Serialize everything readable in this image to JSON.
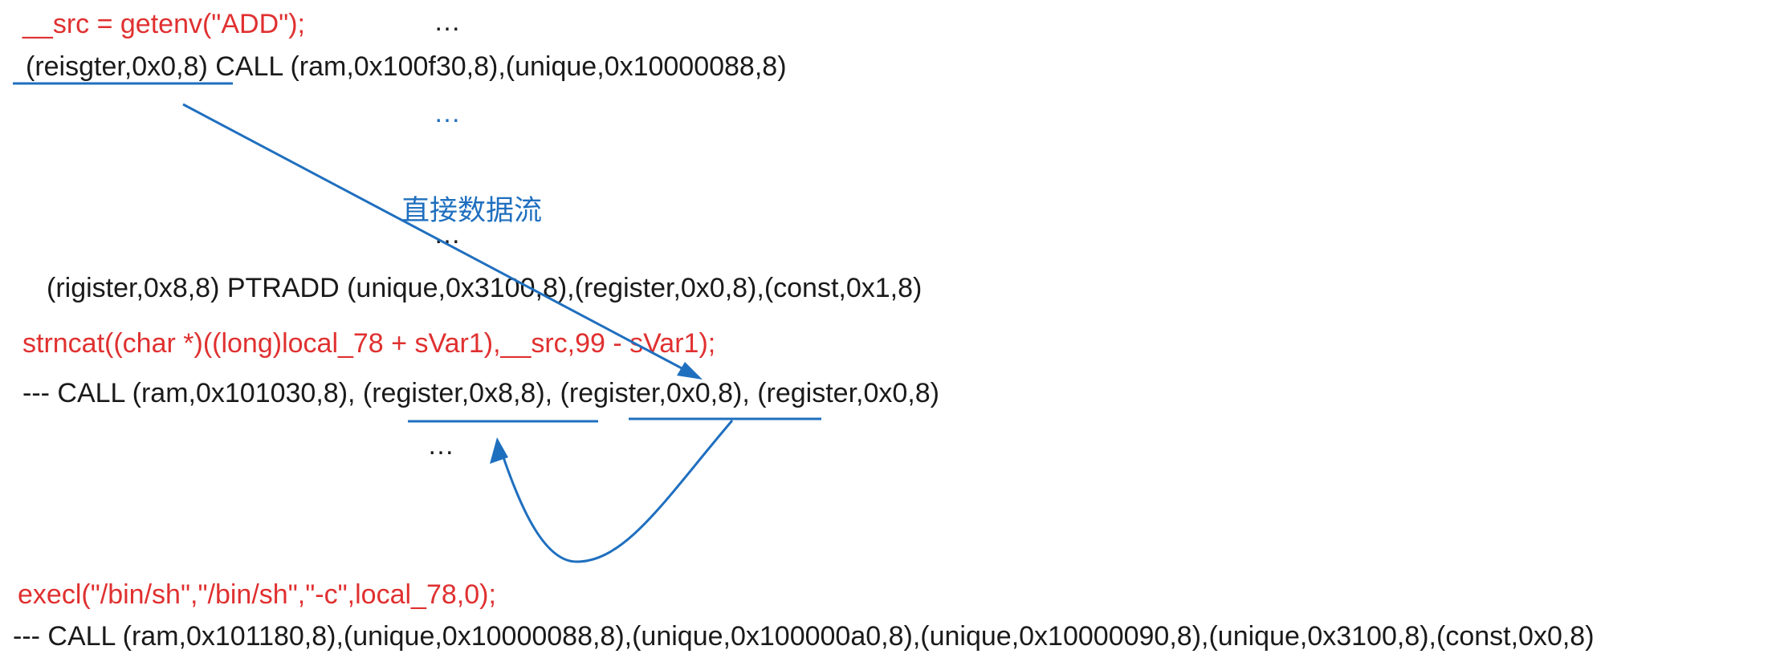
{
  "lines": {
    "src_getenv": "__src = getenv(\"ADD\");",
    "ellipsis_top": "…",
    "call_getenv": "(reisgter,0x0,8) CALL (ram,0x100f30,8),(unique,0x10000088,8)",
    "ellipsis_blue": "…",
    "direct_dataflow_label": "直接数据流",
    "ellipsis_mid": "…",
    "ptradd": "(rigister,0x8,8) PTRADD (unique,0x3100,8),(register,0x0,8),(const,0x1,8)",
    "strncat_src": "strncat((char *)((long)local_78 + sVar1),__src,99 - sVar1);",
    "call_strncat": "--- CALL (ram,0x101030,8), (register,0x8,8), (register,0x0,8), (register,0x0,8)",
    "ellipsis_low": "…",
    "execl_src": "execl(\"/bin/sh\",\"/bin/sh\",\"-c\",local_78,0);",
    "call_execl": "--- CALL (ram,0x101180,8),(unique,0x10000088,8),(unique,0x100000a0,8),(unique,0x10000090,8),(unique,0x3100,8),(const,0x0,8)"
  },
  "colors": {
    "source_code": "#e03030",
    "pcode": "#1a1a1a",
    "flow": "#1f6fbf"
  }
}
